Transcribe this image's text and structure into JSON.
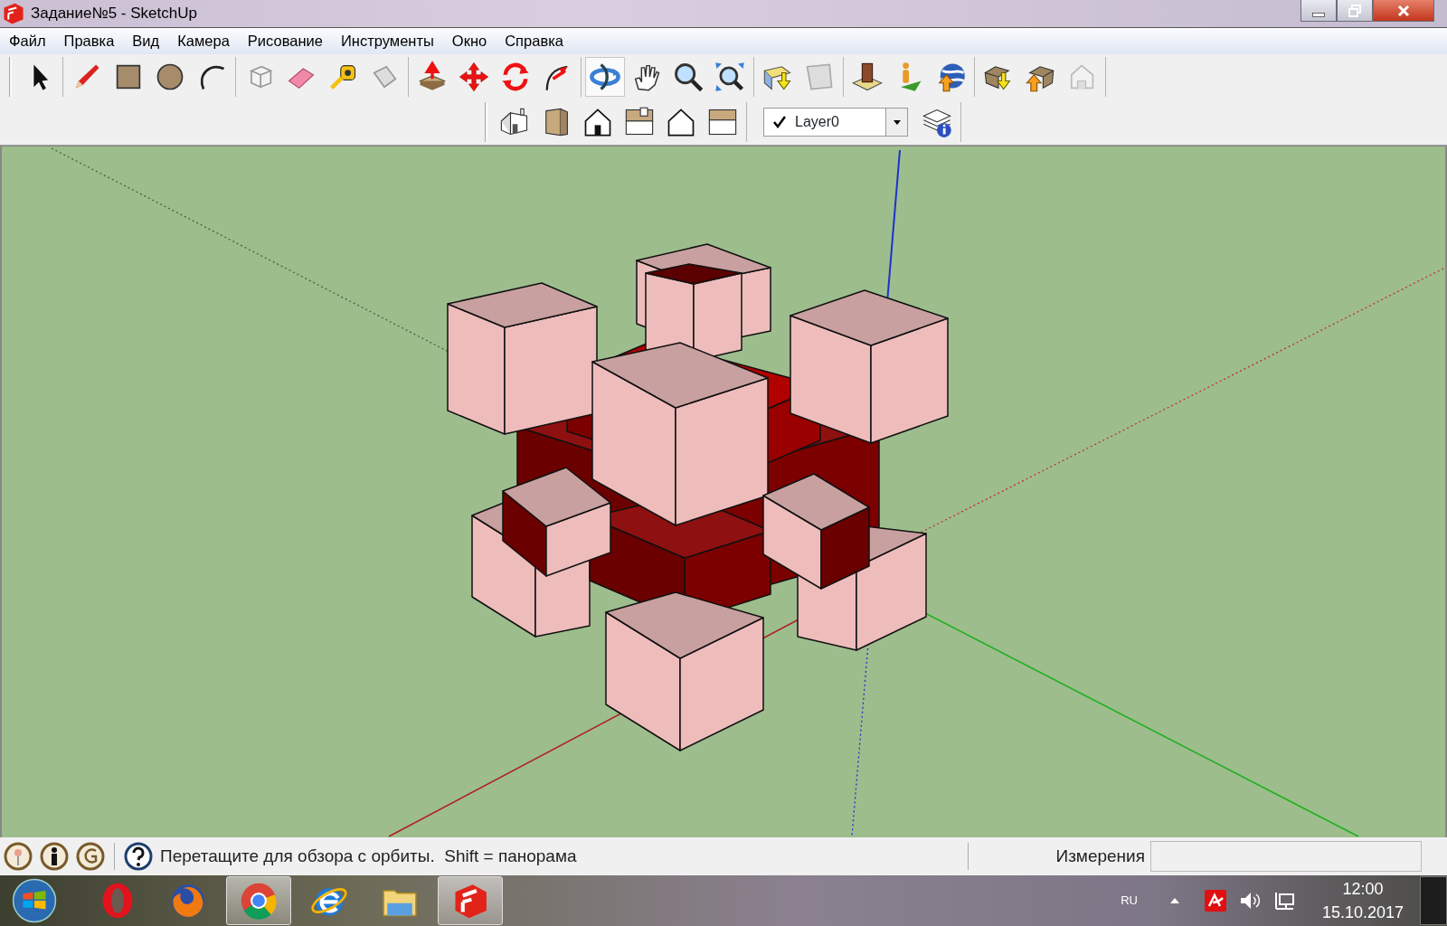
{
  "window": {
    "title": "Задание№5 - SketchUp"
  },
  "menu": [
    "Файл",
    "Правка",
    "Вид",
    "Камера",
    "Рисование",
    "Инструменты",
    "Окно",
    "Справка"
  ],
  "main_toolbar": {
    "buttons": [
      {
        "selected": false
      },
      {
        "selected": false
      },
      {
        "selected": false
      },
      {
        "selected": false
      },
      {
        "selected": false
      },
      {
        "selected": false
      },
      {
        "selected": false
      },
      {
        "selected": false
      },
      {
        "selected": false
      },
      {
        "selected": false
      },
      {
        "selected": false
      },
      {
        "selected": false
      },
      {
        "selected": false
      },
      {
        "selected": true
      },
      {
        "selected": false
      },
      {
        "selected": false
      },
      {
        "selected": false
      },
      {
        "selected": false
      },
      {
        "selected": false
      },
      {
        "selected": false
      },
      {
        "selected": false
      },
      {
        "selected": false
      },
      {
        "selected": false
      },
      {
        "selected": false
      },
      {
        "selected": false
      }
    ]
  },
  "layer_select": {
    "checked": true,
    "value": "Layer0"
  },
  "status_bar": {
    "hint": "Перетащите для обзора с орбиты.  Shift = панорама",
    "measurements_label": "Измерения"
  },
  "taskbar": {
    "apps": [
      {
        "active": false
      },
      {
        "active": false
      },
      {
        "active": true
      },
      {
        "active": false
      },
      {
        "active": false
      },
      {
        "active": true
      }
    ],
    "language": "RU",
    "time": "12:00",
    "date": "15.10.2017"
  }
}
